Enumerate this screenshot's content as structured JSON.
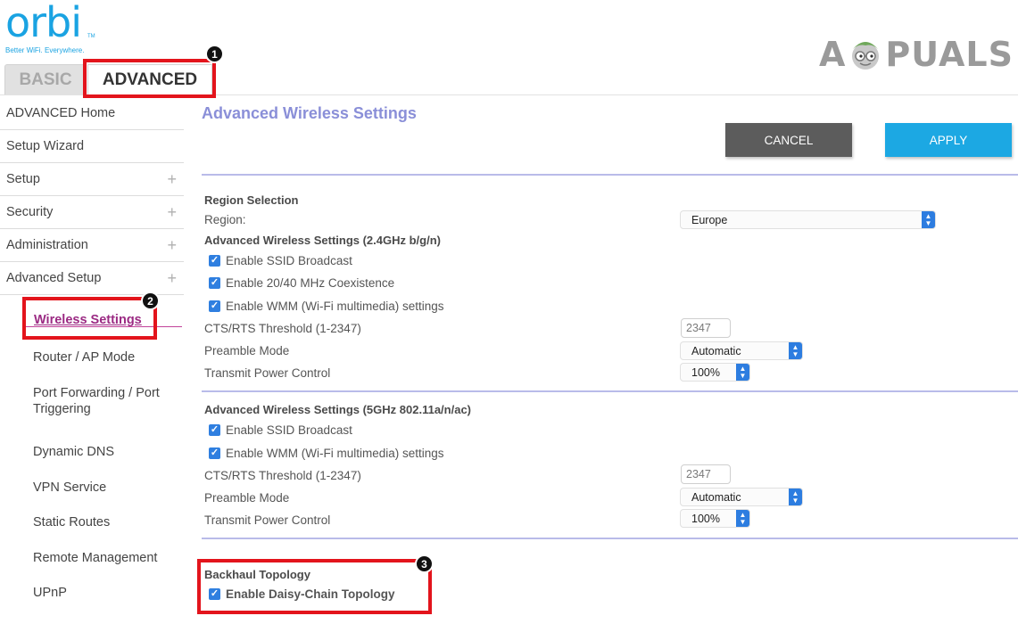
{
  "header": {
    "logo_text": "orbi",
    "logo_tm": "TM",
    "logo_tagline": "Better WiFi. Everywhere.",
    "watermark_left": "A",
    "watermark_right": "PUALS"
  },
  "tabs": [
    {
      "label": "BASIC"
    },
    {
      "label": "ADVANCED"
    }
  ],
  "sidebar": {
    "items": [
      {
        "label": "ADVANCED Home"
      },
      {
        "label": "Setup Wizard"
      },
      {
        "label": "Setup",
        "expand": "+"
      },
      {
        "label": "Security",
        "expand": "+"
      },
      {
        "label": "Administration",
        "expand": "+"
      },
      {
        "label": "Advanced Setup",
        "expand": "+"
      }
    ],
    "sub_items": [
      {
        "label": "Wireless Settings"
      },
      {
        "label": "Router / AP Mode"
      },
      {
        "label": "Port Forwarding / Port Triggering"
      },
      {
        "label": "Dynamic DNS"
      },
      {
        "label": "VPN Service"
      },
      {
        "label": "Static Routes"
      },
      {
        "label": "Remote Management"
      },
      {
        "label": "UPnP"
      }
    ]
  },
  "main": {
    "title": "Advanced Wireless Settings",
    "cancel_label": "CANCEL",
    "apply_label": "APPLY",
    "region": {
      "section_title": "Region Selection",
      "label": "Region:",
      "value": "Europe"
    },
    "band_24": {
      "section_title": "Advanced Wireless Settings (2.4GHz b/g/n)",
      "checkboxes": [
        "Enable SSID Broadcast",
        "Enable 20/40 MHz Coexistence",
        "Enable WMM (Wi-Fi multimedia) settings"
      ],
      "cts_label": "CTS/RTS Threshold (1-2347)",
      "cts_value": "2347",
      "preamble_label": "Preamble Mode",
      "preamble_value": "Automatic",
      "power_label": "Transmit Power Control",
      "power_value": "100%"
    },
    "band_5": {
      "section_title": "Advanced Wireless Settings (5GHz 802.11a/n/ac)",
      "checkboxes": [
        "Enable SSID Broadcast",
        "Enable WMM (Wi-Fi multimedia) settings"
      ],
      "cts_label": "CTS/RTS Threshold (1-2347)",
      "cts_value": "2347",
      "preamble_label": "Preamble Mode",
      "preamble_value": "Automatic",
      "power_label": "Transmit Power Control",
      "power_value": "100%"
    },
    "backhaul": {
      "section_title": "Backhaul Topology",
      "checkbox": "Enable Daisy-Chain Topology"
    }
  },
  "badges": [
    "1",
    "2",
    "3"
  ],
  "colors": {
    "highlight": "#e3141c",
    "accent_blue": "#1ca8e3",
    "title_purple": "#8a8fd8",
    "active_link": "#9b2a83"
  }
}
